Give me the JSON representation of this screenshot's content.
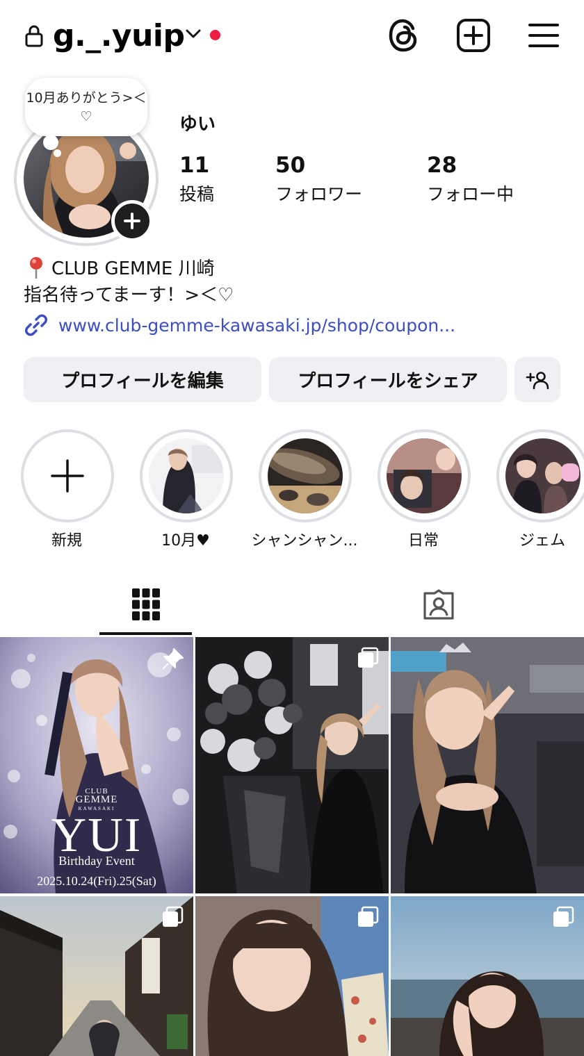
{
  "header": {
    "username": "g._.yuip",
    "notification_color": "#ed1c40"
  },
  "profile": {
    "note": "10月ありがとう>＜♡",
    "display_name": "ゆい",
    "stats": [
      {
        "value": "11",
        "label": "投稿"
      },
      {
        "value": "50",
        "label": "フォロワー"
      },
      {
        "value": "28",
        "label": "フォロー中"
      }
    ],
    "bio_location": "CLUB GEMME 川崎",
    "bio_location_icon": "pin-icon",
    "bio_text": "指名待ってまーす！>＜♡",
    "link": "www.club-gemme-kawasaki.jp/shop/coupon..."
  },
  "buttons": {
    "edit_profile": "プロフィールを編集",
    "share_profile": "プロフィールをシェア"
  },
  "highlights": [
    {
      "label": "新規"
    },
    {
      "label": "10月♥"
    },
    {
      "label": "シャンシャン..."
    },
    {
      "label": "日常"
    },
    {
      "label": "ジェム"
    }
  ],
  "posts": {
    "first_post": {
      "club_small": "CLUB",
      "club_name": "GEMME",
      "club_city": "KAWASAKI",
      "title": "YUI",
      "subtitle": "Birthday Event",
      "date": "2025.10.24(Fri).25(Sat)"
    }
  },
  "colors": {
    "link": "#3b4ec4",
    "button_bg": "#eff0f3",
    "ring": "#d9dbe0"
  }
}
